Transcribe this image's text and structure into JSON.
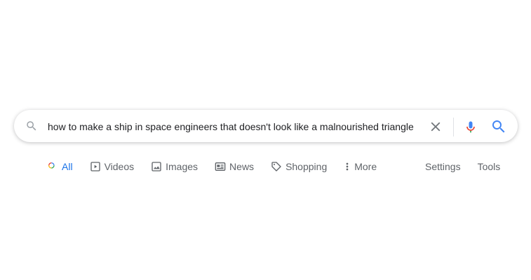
{
  "search": {
    "query": "how to make a ship in space engineers that doesn't look like a malnourished triangle"
  },
  "tabs": [
    {
      "label": "All",
      "icon": "search-multicolor-icon",
      "active": true
    },
    {
      "label": "Videos",
      "icon": "play-icon"
    },
    {
      "label": "Images",
      "icon": "image-icon"
    },
    {
      "label": "News",
      "icon": "news-icon"
    },
    {
      "label": "Shopping",
      "icon": "tag-icon"
    },
    {
      "label": "More",
      "icon": "more-vertical-icon"
    }
  ],
  "tools": {
    "settings_label": "Settings",
    "tools_label": "Tools"
  },
  "colors": {
    "accent": "#1a73e8",
    "text_secondary": "#5f6368",
    "text_primary": "#202124"
  }
}
